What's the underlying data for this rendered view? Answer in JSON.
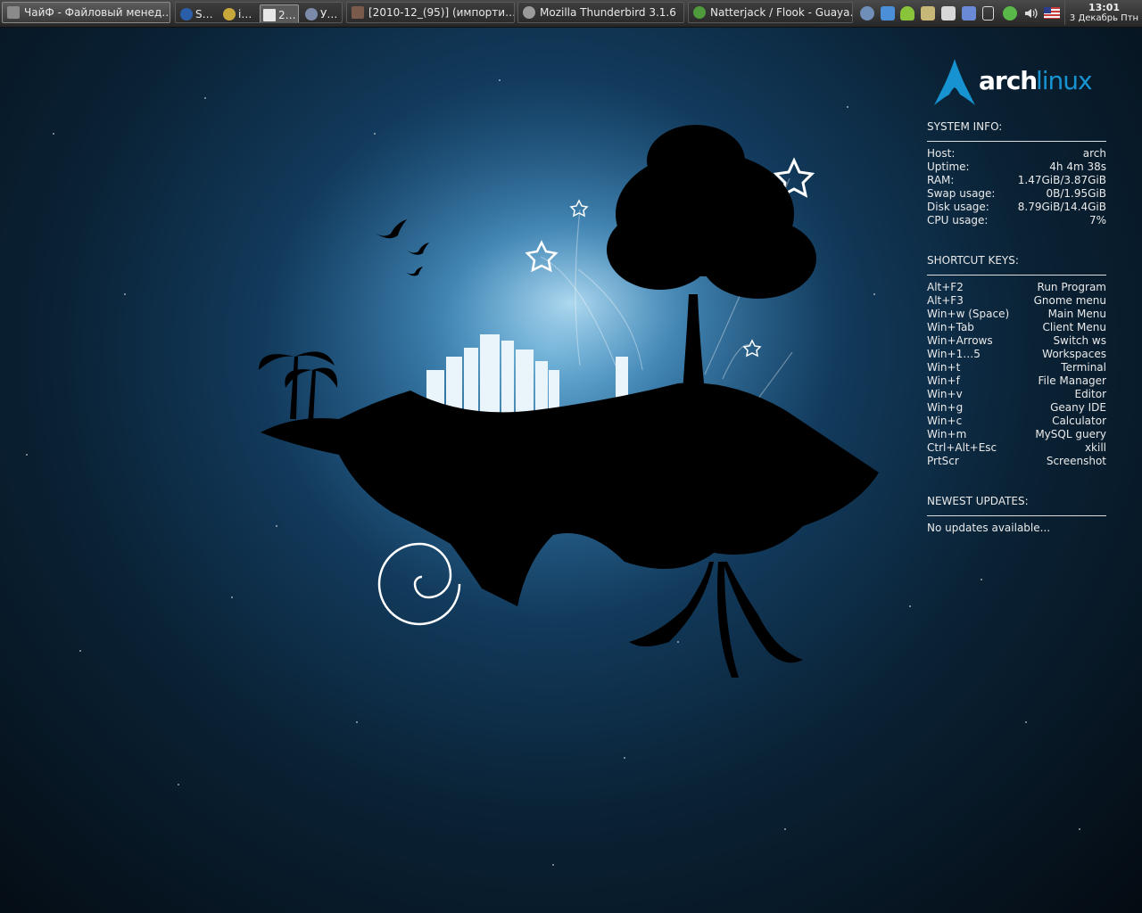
{
  "taskbar": {
    "tasks": [
      {
        "label": "ЧайФ - Файловый менед…",
        "icon": "folder-icon",
        "color": "#8a8a8a"
      },
      {
        "label": "[2010-12_(95)] (импорти…",
        "icon": "image-thumbnail-icon",
        "color": "#7a5a4a"
      },
      {
        "label": "Mozilla Thunderbird 3.1.6",
        "icon": "thunderbird-icon",
        "color": "#9a9a9a"
      },
      {
        "label": "Natterjack / Flook - Guaya…",
        "icon": "flock-browser-icon",
        "color": "#4f9a3a"
      }
    ],
    "group": [
      {
        "label": "S…",
        "icon": "globe-icon",
        "color": "#2a5ea8"
      },
      {
        "label": "i…",
        "icon": "chat-icon",
        "color": "#c8a83a"
      },
      {
        "label": "2…",
        "icon": "document-icon",
        "color": "#e8e8e8"
      },
      {
        "label": "У…",
        "icon": "skype-icon",
        "color": "#7a8aa8"
      }
    ],
    "tray": [
      {
        "icon": "network-icon",
        "color": "#6f8fb8"
      },
      {
        "icon": "dropbox-icon",
        "color": "#4a8fd8"
      },
      {
        "icon": "android-icon",
        "color": "#8ac43a"
      },
      {
        "icon": "book-icon",
        "color": "#c8b878"
      },
      {
        "icon": "notes-icon",
        "color": "#d8d8d8"
      },
      {
        "icon": "messenger-icon",
        "color": "#6a8ad8"
      },
      {
        "icon": "window-icon",
        "color": "#d8d8d8"
      },
      {
        "icon": "update-icon",
        "color": "#5ab84a"
      },
      {
        "icon": "volume-icon",
        "color": "#dcdcdc"
      },
      {
        "icon": "us-flag-icon",
        "color": "#b83a3a"
      }
    ],
    "clock": {
      "time": "13:01",
      "date": "3 Декабрь Птн"
    }
  },
  "conky": {
    "logo": {
      "arch": "arch",
      "linux": "linux",
      "arch_color": "#ffffff",
      "linux_color": "#1793d1"
    },
    "system_info": {
      "title": "SYSTEM INFO:",
      "rows": [
        {
          "key": "Host:",
          "value": "arch"
        },
        {
          "key": "Uptime:",
          "value": "4h 4m 38s"
        },
        {
          "key": "RAM:",
          "value": "1.47GiB/3.87GiB"
        },
        {
          "key": "Swap usage:",
          "value": "0B/1.95GiB"
        },
        {
          "key": "Disk usage:",
          "value": "8.79GiB/14.4GiB"
        },
        {
          "key": "CPU usage:",
          "value": "7%"
        }
      ]
    },
    "shortcuts": {
      "title": "SHORTCUT KEYS:",
      "rows": [
        {
          "key": "Alt+F2",
          "value": "Run Program"
        },
        {
          "key": "Alt+F3",
          "value": "Gnome menu"
        },
        {
          "key": "Win+w (Space)",
          "value": "Main Menu"
        },
        {
          "key": "Win+Tab",
          "value": "Client Menu"
        },
        {
          "key": "Win+Arrows",
          "value": "Switch ws"
        },
        {
          "key": "Win+1…5",
          "value": "Workspaces"
        },
        {
          "key": "Win+t",
          "value": "Terminal"
        },
        {
          "key": "Win+f",
          "value": "File Manager"
        },
        {
          "key": "Win+v",
          "value": "Editor"
        },
        {
          "key": "Win+g",
          "value": "Geany IDE"
        },
        {
          "key": "Win+c",
          "value": "Calculator"
        },
        {
          "key": "Win+m",
          "value": "MySQL guery"
        },
        {
          "key": "Ctrl+Alt+Esc",
          "value": "xkill"
        },
        {
          "key": "PrtScr",
          "value": "Screenshot"
        }
      ]
    },
    "updates": {
      "title": "NEWEST UPDATES:",
      "message": "No updates available..."
    }
  }
}
